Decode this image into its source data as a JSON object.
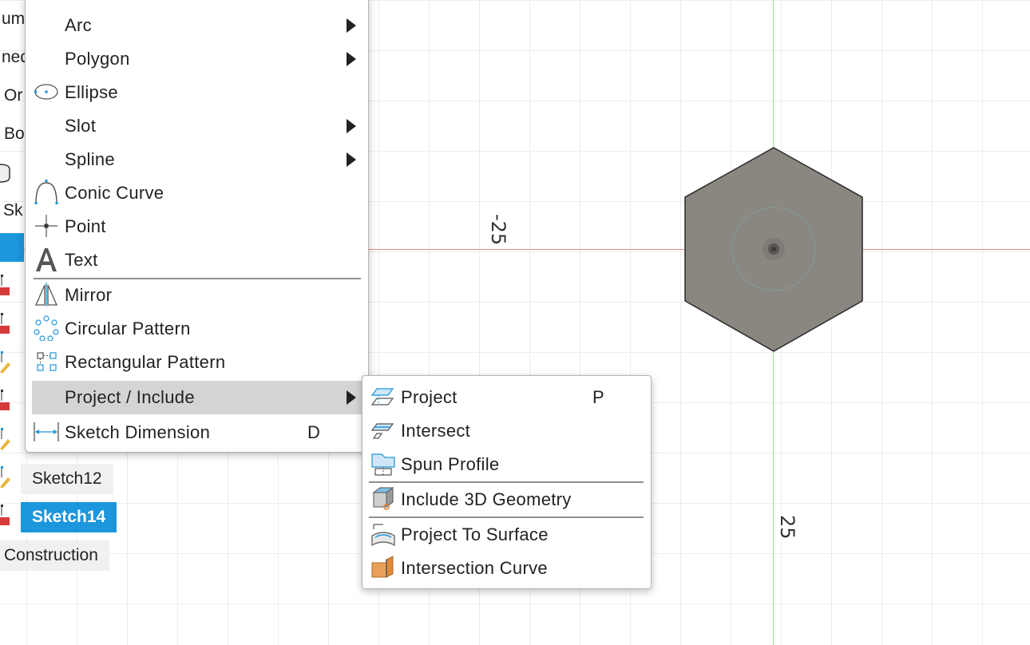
{
  "canvas": {
    "dimension_negative": "-25",
    "dimension_positive": "25"
  },
  "browser": {
    "cut_labels": [
      "um",
      "ned",
      "Or",
      "Bo",
      "Sk"
    ],
    "tree_items": [
      {
        "label": "Sketch12",
        "selected": false
      },
      {
        "label": "Sketch14",
        "selected": true
      },
      {
        "label": "Construction",
        "selected": false
      }
    ]
  },
  "menu": {
    "items": [
      {
        "label": "Arc",
        "icon": "arc-icon",
        "submenu": true
      },
      {
        "label": "Polygon",
        "icon": "polygon-icon",
        "submenu": true
      },
      {
        "label": "Ellipse",
        "icon": "ellipse-icon",
        "submenu": false
      },
      {
        "label": "Slot",
        "icon": "slot-icon",
        "submenu": true
      },
      {
        "label": "Spline",
        "icon": "spline-icon",
        "submenu": true
      },
      {
        "label": "Conic Curve",
        "icon": "conic-curve-icon",
        "submenu": false
      },
      {
        "label": "Point",
        "icon": "point-icon",
        "submenu": false
      },
      {
        "label": "Text",
        "icon": "text-icon",
        "submenu": false
      },
      {
        "label": "Mirror",
        "icon": "mirror-icon",
        "submenu": false
      },
      {
        "label": "Circular Pattern",
        "icon": "circular-pattern-icon",
        "submenu": false
      },
      {
        "label": "Rectangular Pattern",
        "icon": "rectangular-pattern-icon",
        "submenu": false
      },
      {
        "label": "Project / Include",
        "icon": "",
        "submenu": true,
        "highlighted": true
      },
      {
        "label": "Sketch Dimension",
        "icon": "sketch-dimension-icon",
        "shortcut": "D"
      }
    ]
  },
  "submenu": {
    "items": [
      {
        "label": "Project",
        "icon": "project-icon",
        "shortcut": "P"
      },
      {
        "label": "Intersect",
        "icon": "intersect-icon"
      },
      {
        "label": "Spun Profile",
        "icon": "spun-profile-icon"
      },
      {
        "label": "Include 3D Geometry",
        "icon": "include-3d-geometry-icon"
      },
      {
        "label": "Project To Surface",
        "icon": "project-to-surface-icon"
      },
      {
        "label": "Intersection Curve",
        "icon": "intersection-curve-icon"
      }
    ]
  },
  "colors": {
    "selection_blue": "#1c96dc",
    "hexagon_fill": "#8a8680",
    "axis_red": "#e88a8a",
    "axis_green": "#9be39b",
    "highlight_gray": "#d4d4d4"
  }
}
